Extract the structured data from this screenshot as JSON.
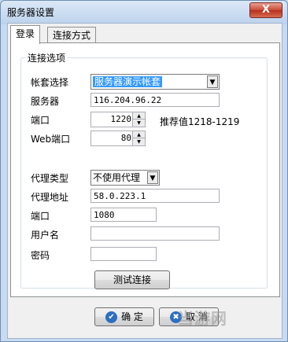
{
  "window": {
    "title": "服务器设置",
    "close_glyph": "X"
  },
  "tabs": [
    {
      "label": "登录",
      "active": true
    },
    {
      "label": "连接方式",
      "active": false
    }
  ],
  "group": {
    "legend": "连接选项"
  },
  "fields": {
    "account_set": {
      "label": "帐套选择",
      "value": "服务器演示帐套"
    },
    "server": {
      "label": "服务器",
      "value": "116.204.96.22"
    },
    "port": {
      "label": "端口",
      "value": "1220",
      "hint": "推荐值1218-1219"
    },
    "web_port": {
      "label": "Web端口",
      "value": "80"
    },
    "proxy_type": {
      "label": "代理类型",
      "value": "不使用代理"
    },
    "proxy_address": {
      "label": "代理地址",
      "value": "58.0.223.1"
    },
    "proxy_port": {
      "label": "端口",
      "value": "1080"
    },
    "username": {
      "label": "用户名",
      "value": ""
    },
    "password": {
      "label": "密码",
      "value": ""
    }
  },
  "buttons": {
    "test_connection": "测试连接",
    "ok": "确 定",
    "cancel": "取 消"
  },
  "watermark": "当游网"
}
